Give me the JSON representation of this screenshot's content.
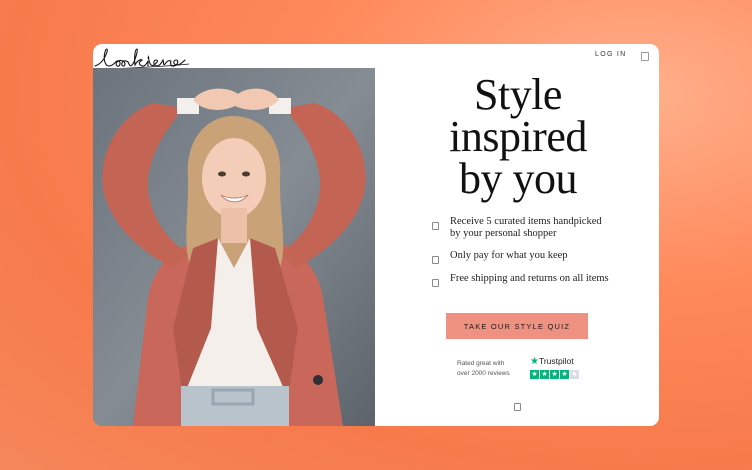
{
  "brand": {
    "logo_text": "lookiero"
  },
  "header": {
    "login_label": "LOG IN"
  },
  "hero": {
    "headline_lines": [
      "Style",
      "inspired",
      "by you"
    ]
  },
  "benefits": [
    {
      "text": "Receive 5 curated items handpicked by your personal shopper"
    },
    {
      "text": "Only pay for what you keep"
    },
    {
      "text": "Free shipping and returns on all items"
    }
  ],
  "cta": {
    "label": "TAKE OUR STYLE QUIZ"
  },
  "rating": {
    "line1": "Rated great with",
    "line2": "over 2000 reviews",
    "provider": "Trustpilot",
    "stars_filled": 4,
    "stars_total": 5,
    "star_color": "#00b67a"
  },
  "colors": {
    "background": "#f77a4b",
    "cta_background": "#ef9180",
    "card": "#ffffff"
  }
}
